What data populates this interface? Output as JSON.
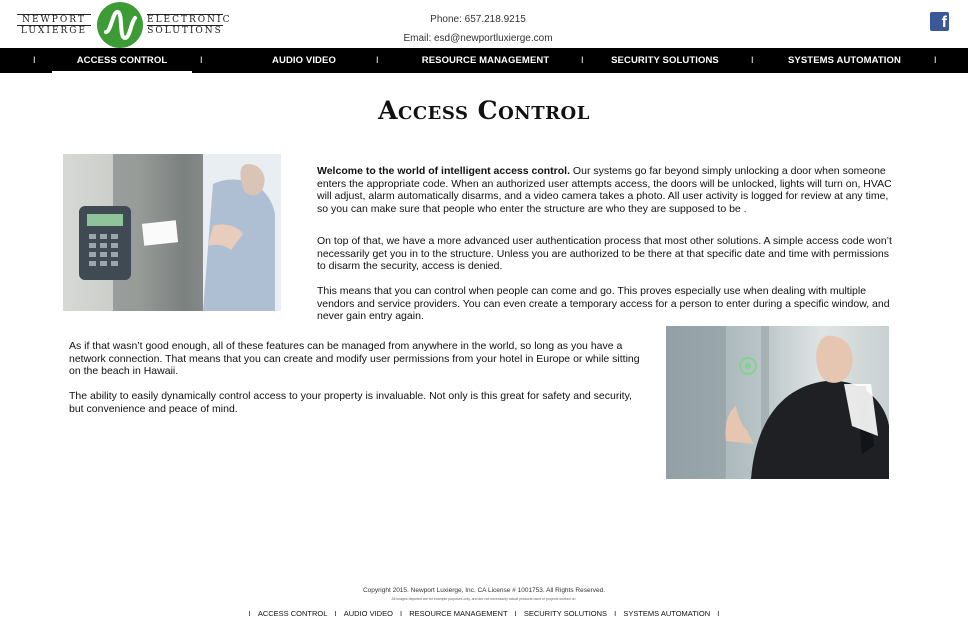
{
  "brand": {
    "left_line1": "NEWPORT",
    "left_line2": "LUXIERGE",
    "right_line1": "ELECTRONIC",
    "right_line2": "SOLUTIONS",
    "mark_color": "#3d9b35"
  },
  "contact": {
    "phone": "Phone: 657.218.9215",
    "email": "Email: esd@newportluxierge.com"
  },
  "social": {
    "facebook_glyph": "f"
  },
  "nav": {
    "separator": "I",
    "items": [
      {
        "label": "ACCESS CONTROL"
      },
      {
        "label": "AUDIO VIDEO"
      },
      {
        "label": "RESOURCE MANAGEMENT"
      },
      {
        "label": "SECURITY SOLUTIONS"
      },
      {
        "label": "SYSTEMS AUTOMATION"
      }
    ]
  },
  "page": {
    "title": "Access Control",
    "intro_bold": "Welcome to the world of intelligent access control.",
    "intro_rest": " Our systems go far beyond simply unlocking a door when someone enters the appropriate code. When an authorized user attempts access, the doors will be unlocked, lights will turn on, HVAC will adjust, alarm automatically disarms, and a video camera takes a photo. All user activity is logged for review at any time, so you can make sure that people who enter the structure are who they are supposed to be .",
    "para2": "On top of that, we have a more advanced user authentication process that most other solutions. A simple access code won’t necessarily get you in to the structure. Unless you are authorized to be there at that specific date and time with permissions to disarm the security, access is denied.",
    "para3": "This means that you can control when people can come and go. This proves especially use when dealing with multiple vendors and service providers. You can even create a temporary access for a person to enter during a specific window, and never gain entry again.",
    "para4": "As if that wasn’t good enough, all of these features can be managed from anywhere in the world, so long as you have a network connection. That means that you can create and modify user permissions from your hotel in Europe or while sitting on the beach in Hawaii.",
    "para5": "The ability to easily dynamically control access to your property is invaluable. Not only is this great for safety and security, but convenience and peace of mind."
  },
  "footer": {
    "copyright": "Copyright 2015. Newport Luxierge, Inc. CA License # 1001753. All Rights Reserved.",
    "disclaimer": "All images depicted are for example purposes only, and are not necessarily actual products used or projects worked on.",
    "separator": "I",
    "links": [
      {
        "label": "ACCESS CONTROL"
      },
      {
        "label": "AUDIO VIDEO"
      },
      {
        "label": "RESOURCE MANAGEMENT"
      },
      {
        "label": "SECURITY SOLUTIONS"
      },
      {
        "label": "SYSTEMS AUTOMATION"
      }
    ]
  }
}
